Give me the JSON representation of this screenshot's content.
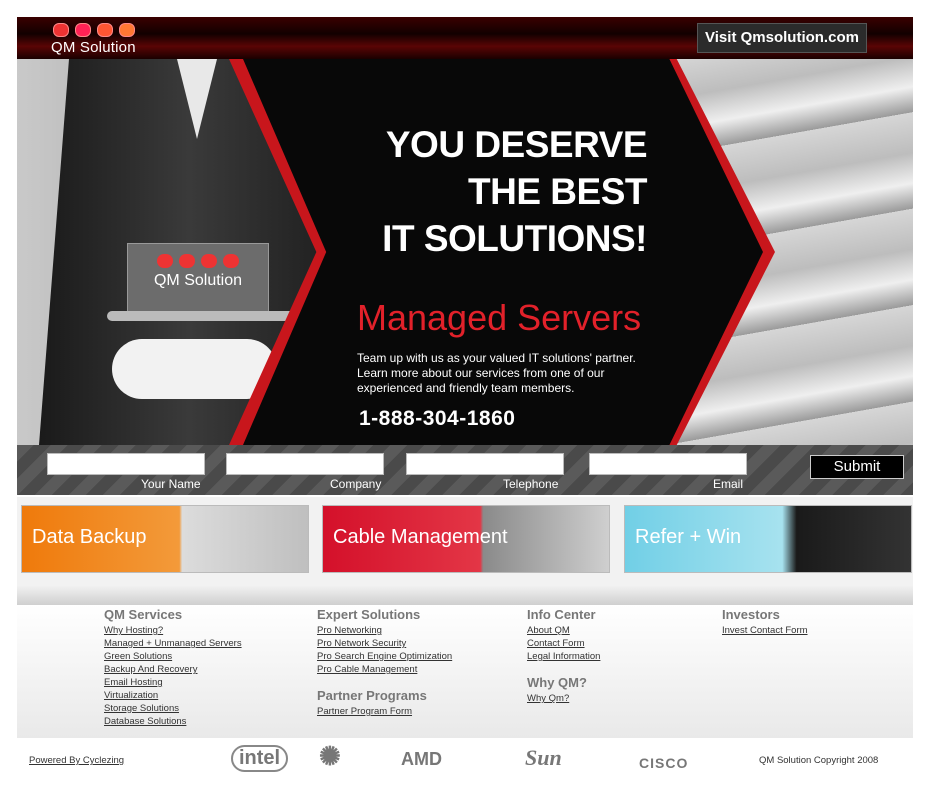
{
  "header": {
    "logo_text": "QM Solution",
    "visit_button": "Visit Qmsolution.com"
  },
  "hero": {
    "headline_line1": "YOU DESERVE",
    "headline_line2": "THE BEST",
    "headline_line3": "IT SOLUTIONS!",
    "subhead": "Managed Servers",
    "description": "Team up with us as your valued IT solutions' partner. Learn more about our services from one of our experienced and friendly team members.",
    "phone": "1-888-304-1860",
    "tray_logo_text": "QM Solution"
  },
  "form": {
    "labels": {
      "name": "Your Name",
      "company": "Company",
      "telephone": "Telephone",
      "email": "Email"
    },
    "submit": "Submit"
  },
  "banners": [
    {
      "label": "Data Backup"
    },
    {
      "label": "Cable Management"
    },
    {
      "label": "Refer + Win"
    }
  ],
  "footer": {
    "qm_services": {
      "title": "QM Services",
      "links": [
        "Why Hosting?",
        "Managed + Unmanaged Servers",
        "Green Solutions",
        "Backup And Recovery",
        "Email Hosting",
        "Virtualization",
        "Storage Solutions",
        "Database Solutions"
      ]
    },
    "expert_solutions": {
      "title": "Expert Solutions",
      "links": [
        "Pro Networking",
        "Pro Network Security",
        "Pro Search Engine Optimization",
        "Pro Cable Management"
      ]
    },
    "partner_programs": {
      "title": "Partner Programs",
      "links": [
        "Partner Program Form"
      ]
    },
    "info_center": {
      "title": "Info Center",
      "links": [
        "About QM",
        "Contact Form",
        "Legal Information"
      ]
    },
    "why_qm": {
      "title": "Why QM?",
      "links": [
        "Why Qm?"
      ]
    },
    "investors": {
      "title": "Investors",
      "links": [
        "Invest Contact Form"
      ]
    }
  },
  "bottom": {
    "powered_by": "Powered By Cyclezing",
    "partners": [
      "intel",
      "AMD",
      "Sun",
      "CISCO"
    ],
    "copyright": "QM Solution Copyright 2008"
  }
}
